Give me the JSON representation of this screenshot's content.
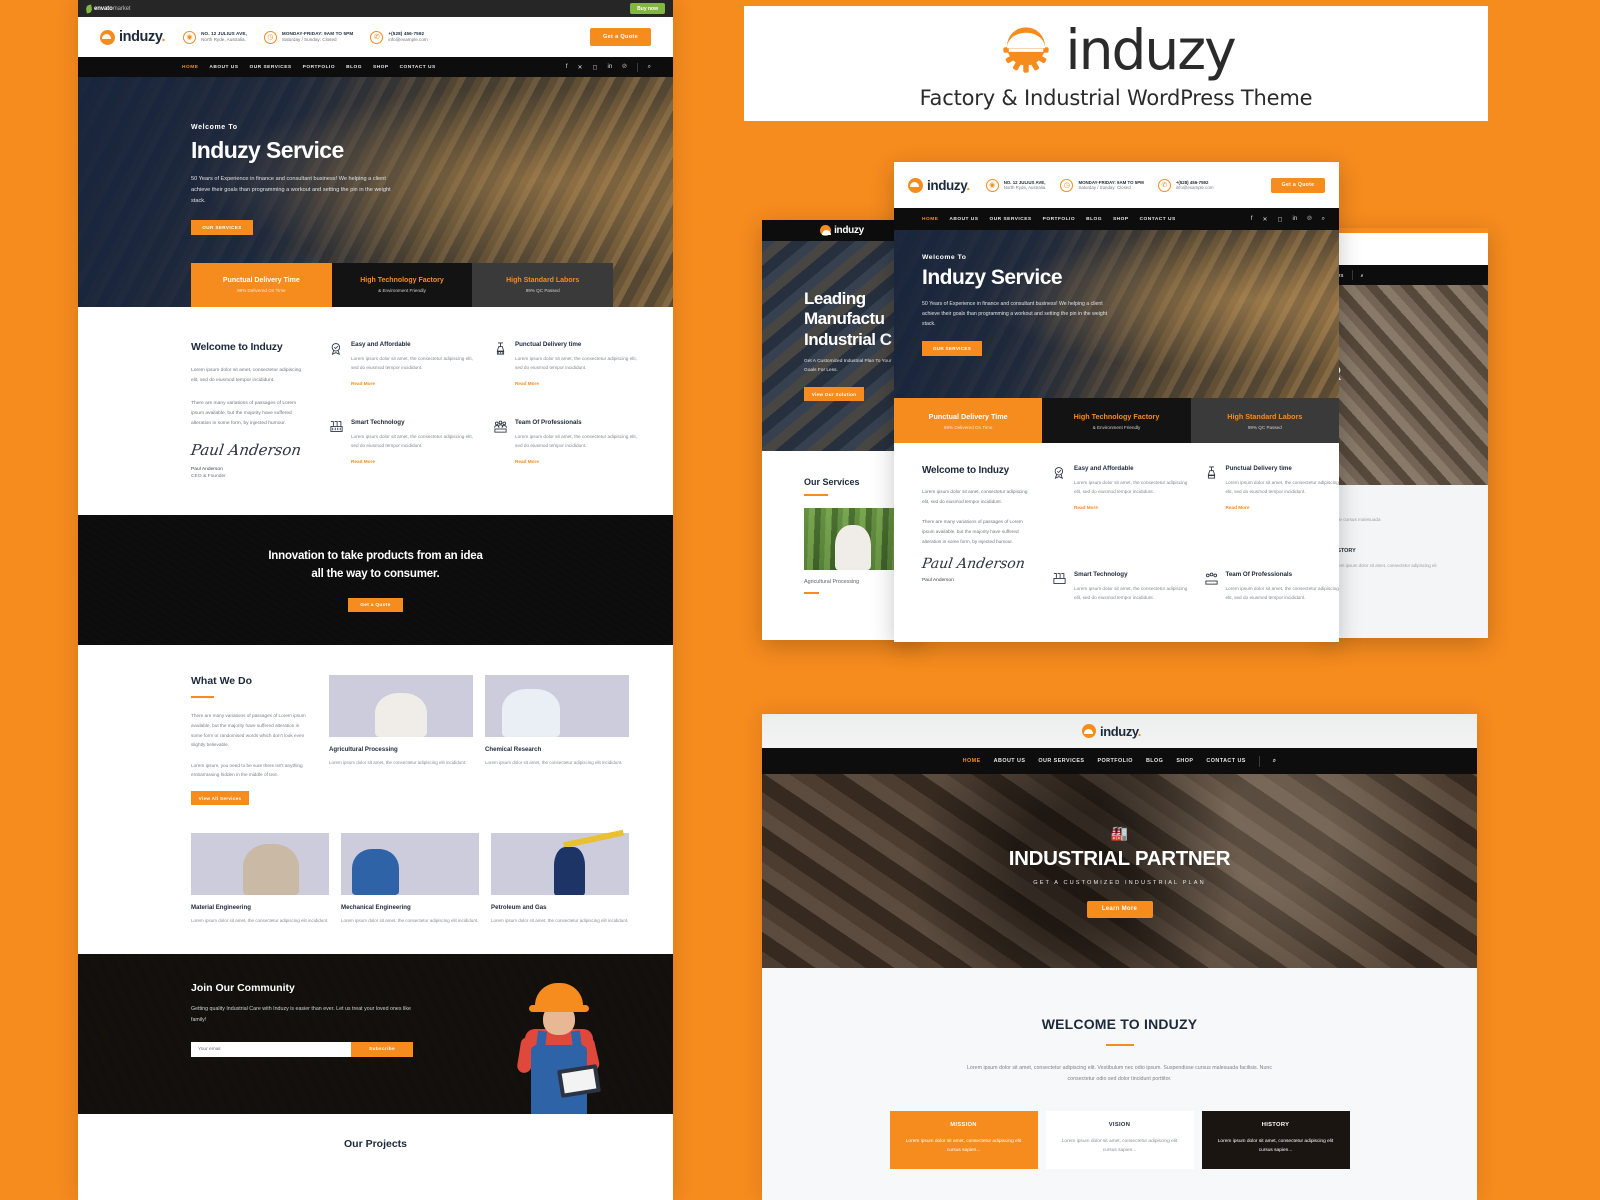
{
  "promo": {
    "logo_text": "induzy",
    "tagline": "Factory & Industrial WordPress Theme"
  },
  "envato": {
    "brand_bold": "envato",
    "brand_light": "market",
    "buy_now": "Buy now"
  },
  "header": {
    "brand": "induzy",
    "brand_dot": ".",
    "info": [
      {
        "icon": "location-pin-icon",
        "line1": "NO. 12 JULIUS AVE,",
        "line2": "North Ryde, Australia."
      },
      {
        "icon": "clock-icon",
        "line1": "MONDAY-FRIDAY: 9AM TO 5PM",
        "line2": "Saturday / Sunday: Closed"
      },
      {
        "icon": "phone-icon",
        "line1": "+(528) 456-7592",
        "line2": "info@example.com"
      }
    ],
    "quote_button": "Get a Quote"
  },
  "nav": {
    "items": [
      "HOME",
      "ABOUT US",
      "OUR SERVICES",
      "PORTFOLIO",
      "BLOG",
      "SHOP",
      "CONTACT US"
    ],
    "active": "HOME",
    "social": [
      "facebook-icon",
      "x-icon",
      "instagram-icon",
      "linkedin-icon",
      "pinterest-icon"
    ],
    "search": "search-icon"
  },
  "hero": {
    "welcome": "Welcome To",
    "title": "Induzy Service",
    "description": "50 Years of Experience in finance and consultant business! We helping a client achieve their goals than programming a workout and setting the pin in the weight stack.",
    "button": "OUR SERVICES"
  },
  "features": [
    {
      "title": "Punctual Delivery Time",
      "subtitle": "99% Delivered On Time",
      "style": "orange"
    },
    {
      "title": "High Technology Factory",
      "subtitle": "& Environment Friendly",
      "style": "black"
    },
    {
      "title": "High Standard Labors",
      "subtitle": "99% QC Passed",
      "style": "gray"
    }
  ],
  "welcome_section": {
    "heading": "Welcome to Induzy",
    "paragraph1": "Lorem ipsum dolor sit amet, consectetur adipiscing elit, sed do eiusmod tempor incididunt.",
    "paragraph2": "There are many variations of passages of Lorem ipsum available, but the majority have suffered alteration in some form, by injected humour.",
    "signature": "Paul Anderson",
    "signer_name": "Paul Anderson",
    "signer_role": "CEO & Founder",
    "items": [
      {
        "icon": "badge-check-icon",
        "title": "Easy and Affordable",
        "text": "Lorem ipsum dolor sit amet, the consectetur adipiscing elit, sed do eiusmod tempor incididunt.",
        "link": "Read More"
      },
      {
        "icon": "delivery-clock-icon",
        "title": "Punctual Delivery time",
        "text": "Lorem ipsum dolor sit amet, the consectetur adipiscing elit, sed do eiusmod tempor incididunt.",
        "link": "Read More"
      },
      {
        "icon": "factory-icon",
        "title": "Smart Technology",
        "text": "Lorem ipsum dolor sit amet, the consectetur adipiscing elit, sed do eiusmod tempor incididunt.",
        "link": "Read More"
      },
      {
        "icon": "team-icon",
        "title": "Team Of Professionals",
        "text": "Lorem ipsum dolor sit amet, the consectetur adipiscing elit, sed do eiusmod tempor incididunt.",
        "link": "Read More"
      }
    ]
  },
  "innovation": {
    "line1": "Innovation to take products from an idea",
    "line2": "all the way to consumer.",
    "button": "Get a Quote"
  },
  "what_we_do": {
    "heading": "What We Do",
    "paragraph1": "There are many variations of passages of Lorem ipsum available, but the majority have suffered alteration in some form or randomised words which don't look even slightly believable.",
    "paragraph2": "Lorem ipsum, you need to be sure there isn't anything embarrassing hidden in the middle of text.",
    "button": "View All Services",
    "services": [
      {
        "title": "Agricultural Processing",
        "text": "Lorem ipsum dolor sit amet, the consectetur adipiscing elit incididunt.",
        "photo": "agriculture-worker-greenhouse"
      },
      {
        "title": "Chemical Research",
        "text": "Lorem ipsum dolor sit amet, the consectetur adipiscing elit incididunt.",
        "photo": "chemists-laboratory"
      },
      {
        "title": "Material Engineering",
        "text": "Lorem ipsum dolor sit amet, the consectetur adipiscing elit incididunt.",
        "photo": "engineers-workbench"
      },
      {
        "title": "Mechanical Engineering",
        "text": "Lorem ipsum dolor sit amet, the consectetur adipiscing elit incididunt.",
        "photo": "technician-robot-arm"
      },
      {
        "title": "Petroleum and Gas",
        "text": "Lorem ipsum dolor sit amet, the consectetur adipiscing elit incididunt.",
        "photo": "oil-rig-worker-crane"
      }
    ]
  },
  "join": {
    "heading": "Join Our Community",
    "text": "Getting quality Industrial Care with Induzy is easier than ever. Let us treat your loved ones like family!",
    "placeholder": "Your email",
    "button": "Subscribe"
  },
  "projects": {
    "heading": "Our Projects"
  },
  "mock_left": {
    "brand": "induzy",
    "hero_title": "Leading Manufactu Industrial C",
    "hero_desc": "Get A Customized Industrial Plan To Your Goals For Less.",
    "hero_button": "View Our Solution",
    "section_heading": "Our Services",
    "card_caption": "Agricultural Processing"
  },
  "mock_right": {
    "nav_item": "CT US",
    "search": "search-icon",
    "hero_title": "ER",
    "line": "dose cursus malesuada",
    "heading": "HISTORY",
    "sub": "Lorem ipsum dolor sit amet, consectetur adipiscing eli"
  },
  "bottom_panel": {
    "brand": "induzy",
    "nav": [
      "HOME",
      "ABOUT US",
      "OUR SERVICES",
      "PORTFOLIO",
      "BLOG",
      "SHOP",
      "CONTACT US"
    ],
    "nav_active": "HOME",
    "search": "search-icon",
    "hero_icon": "factory-icon",
    "hero_title": "INDUSTRIAL PARTNER",
    "hero_sub": "GET A CUSTOMIZED INDUSTRIAL PLAN",
    "hero_button": "Learn More",
    "welcome_heading": "WELCOME TO INDUZY",
    "welcome_text": "Lorem ipsum dolor sit amet, consectetur adipiscing elit. Vestibulum nec odio ipsum. Suspendisse cursus malesuada facilisis. Nunc consectetur odio sed dolor tincidunt porttitor.",
    "cards": [
      {
        "title": "MISSION",
        "text": "Lorem ipsum dolor sit amet, consectetur adipiscing elit cursus sapien...",
        "style": "orange"
      },
      {
        "title": "VISION",
        "text": "Lorem ipsum dolor sit amet, consectetur adipiscing elit cursus sapien...",
        "style": "white"
      },
      {
        "title": "HISTORY",
        "text": "Lorem ipsum dolor sit amet, consectetur adipiscing elit cursus sapien...",
        "style": "dark"
      }
    ]
  },
  "colors": {
    "accent": "#F68B1E",
    "dark": "#0d0d0d",
    "navy": "#1d2a3a",
    "envato_green": "#82b541"
  }
}
